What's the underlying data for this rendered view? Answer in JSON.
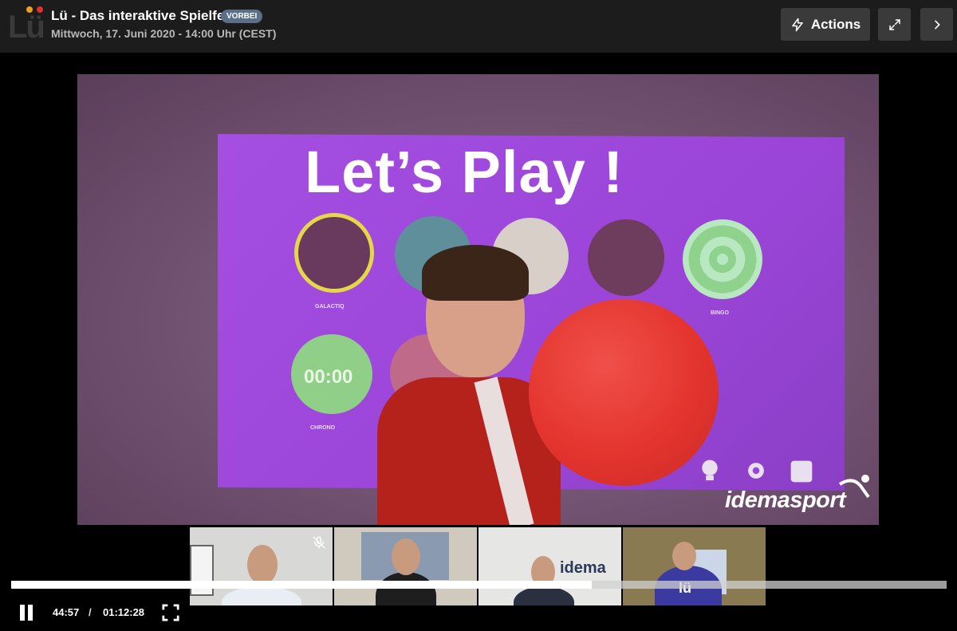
{
  "header": {
    "logo_text": "Lü",
    "title": "Lü - Das interaktive Spielfeld",
    "badge": "VORBEI",
    "subtitle": "Mittwoch, 17. Juni 2020 - 14:00 Uhr (CEST)",
    "actions_label": "Actions"
  },
  "video": {
    "screen_text": "Let’s Play !",
    "watermark": "idemasport",
    "game_labels": [
      "GALACTIQ",
      "CHRONO",
      "BINGO"
    ],
    "chrono_text": "00:00"
  },
  "participants": [
    {
      "name": "participant-1",
      "muted": true
    },
    {
      "name": "participant-2",
      "muted": false
    },
    {
      "name": "participant-3",
      "muted": false,
      "sign_text": "idema"
    },
    {
      "name": "participant-4",
      "muted": false,
      "shirt_text": "lü"
    }
  ],
  "player": {
    "current_time": "44:57",
    "separator": "/",
    "total_time": "01:12:28",
    "progress": 0.621
  },
  "colors": {
    "header_bg": "#1c1c1c",
    "button_bg": "#3a3a3a",
    "badge_bg": "#5b6f8a",
    "screen_purple": "#a44ee2",
    "ball_red": "#e4342e"
  }
}
